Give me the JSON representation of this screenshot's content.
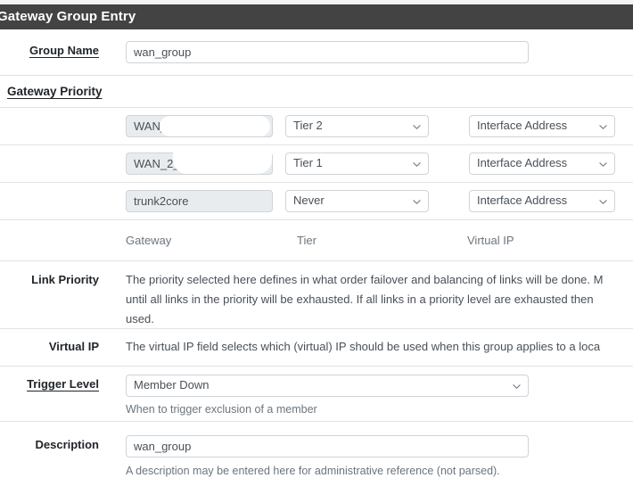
{
  "panel": {
    "title": "Gateway Group Entry"
  },
  "group_name": {
    "label": "Group Name",
    "value": "wan_group",
    "placeholder": ""
  },
  "gateway_priority": {
    "section_label": "Gateway Priority",
    "columns": {
      "gateway": "Gateway",
      "tier": "Tier",
      "virtual_ip": "Virtual IP"
    },
    "rows": [
      {
        "gateway": "WAN_1",
        "tier": "Tier 2",
        "virtual_ip": "Interface Address",
        "redacted": true
      },
      {
        "gateway": "WAN_2_",
        "tier": "Tier 1",
        "virtual_ip": "Interface Address",
        "redacted": true
      },
      {
        "gateway": "trunk2core",
        "tier": "Never",
        "virtual_ip": "Interface Address",
        "redacted": false
      }
    ]
  },
  "link_priority": {
    "label": "Link Priority",
    "lines": [
      "The priority selected here defines in what order failover and balancing of links will be done. M",
      "until all links in the priority will be exhausted. If all links in a priority level are exhausted then ",
      "used."
    ]
  },
  "virtual_ip": {
    "label": "Virtual IP",
    "text": "The virtual IP field selects which (virtual) IP should be used when this group applies to a loca"
  },
  "trigger_level": {
    "label": "Trigger Level",
    "value": "Member Down",
    "help": "When to trigger exclusion of a member"
  },
  "description": {
    "label": "Description",
    "value": "wan_group",
    "help": "A description may be entered here for administrative reference (not parsed)."
  },
  "icons": {
    "chevron_down": "chevron-down-icon"
  },
  "colors": {
    "header_bg": "#434343",
    "header_text": "#ffffff",
    "page_bg": "#ffffff",
    "separator": "#e3e3e3",
    "input_border": "#ced4da",
    "readonly_bg": "#e9ecef",
    "muted_text": "#6c757d",
    "body_text": "#212529"
  }
}
